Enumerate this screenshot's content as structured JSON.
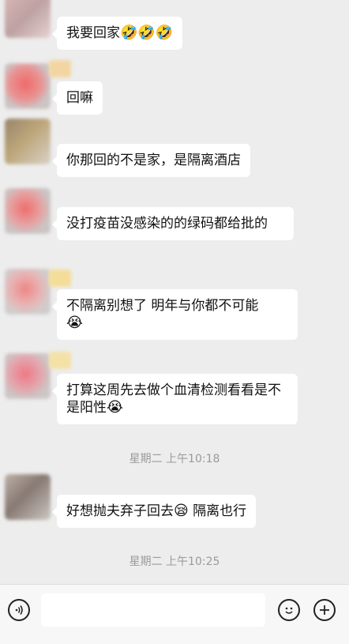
{
  "messages": [
    {
      "text": "我要回家",
      "emoji": "🤣🤣🤣"
    },
    {
      "text": "回嘛",
      "emoji": ""
    },
    {
      "text": "你那回的不是家，是隔离酒店",
      "emoji": ""
    },
    {
      "text": "没打疫苗没感染的的绿码都给批的",
      "emoji": ""
    },
    {
      "text": "不隔离别想了 明年与你都不可能",
      "emoji": "😭"
    },
    {
      "text": " 打算这周先去做个血清检测看看是不是阳性",
      "emoji": "😭"
    },
    {
      "text": "好想抛夫弃子回去",
      "emoji": "😪",
      "text_after": " 隔离也行"
    }
  ],
  "timestamps": [
    "星期二 上午10:18",
    "星期二 上午10:25"
  ],
  "input_bar": {
    "voice_icon": "voice-icon",
    "emoji_icon": "emoji-icon",
    "plus_icon": "plus-icon"
  }
}
